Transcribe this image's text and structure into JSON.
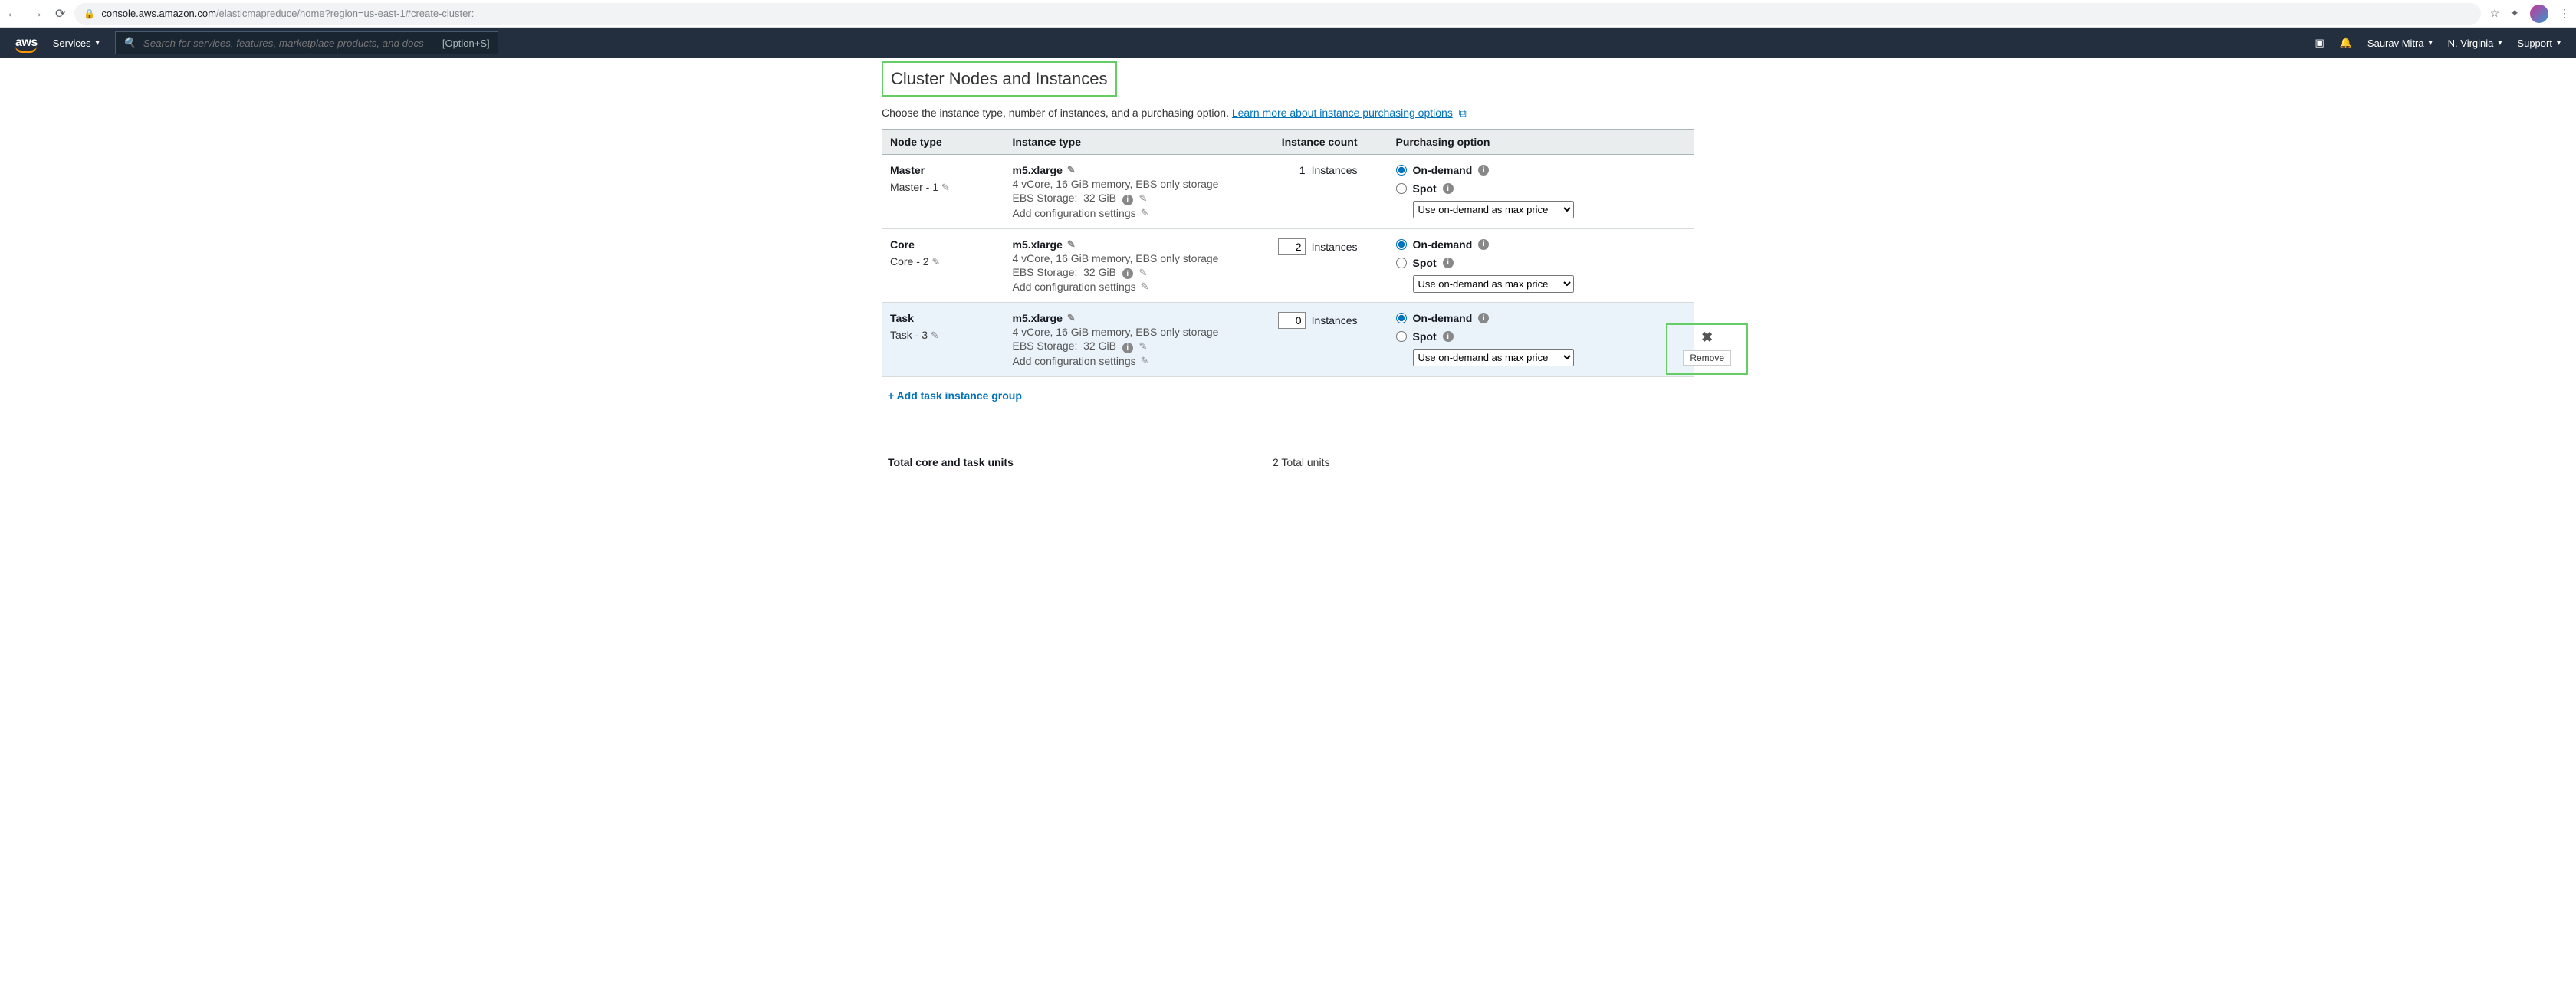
{
  "browser": {
    "url_host": "console.aws.amazon.com",
    "url_path": "/elasticmapreduce/home?region=us-east-1#create-cluster:"
  },
  "nav": {
    "services_label": "Services",
    "search_placeholder": "Search for services, features, marketplace products, and docs",
    "search_shortcut": "[Option+S]",
    "user_label": "Saurav Mitra",
    "region_label": "N. Virginia",
    "support_label": "Support"
  },
  "section": {
    "title": "Cluster Nodes and Instances",
    "description_prefix": "Choose the instance type, number of instances, and a purchasing option. ",
    "link_text": "Learn more about instance purchasing options"
  },
  "columns": {
    "node_type": "Node type",
    "instance_type": "Instance type",
    "instance_count": "Instance count",
    "purchasing_option": "Purchasing option"
  },
  "rows": {
    "master": {
      "name": "Master",
      "sub": "Master - 1",
      "instance_type": "m5.xlarge",
      "specs": "4 vCore, 16 GiB memory, EBS only storage",
      "ebs_label": "EBS Storage:",
      "ebs_value": "32 GiB",
      "config_link": "Add configuration settings",
      "count_value": "1",
      "count_unit": "Instances",
      "on_demand": "On-demand",
      "spot": "Spot",
      "spot_select": "Use on-demand as max price"
    },
    "core": {
      "name": "Core",
      "sub": "Core - 2",
      "instance_type": "m5.xlarge",
      "specs": "4 vCore, 16 GiB memory, EBS only storage",
      "ebs_label": "EBS Storage:",
      "ebs_value": "32 GiB",
      "config_link": "Add configuration settings",
      "count_value": "2",
      "count_unit": "Instances",
      "on_demand": "On-demand",
      "spot": "Spot",
      "spot_select": "Use on-demand as max price"
    },
    "task": {
      "name": "Task",
      "sub": "Task - 3",
      "instance_type": "m5.xlarge",
      "specs": "4 vCore, 16 GiB memory, EBS only storage",
      "ebs_label": "EBS Storage:",
      "ebs_value": "32 GiB",
      "config_link": "Add configuration settings",
      "count_value": "0",
      "count_unit": "Instances",
      "on_demand": "On-demand",
      "spot": "Spot",
      "spot_select": "Use on-demand as max price"
    }
  },
  "remove_tooltip": "Remove",
  "add_task_link": "+ Add task instance group",
  "totals": {
    "label": "Total core and task units",
    "value": "2 Total units"
  }
}
